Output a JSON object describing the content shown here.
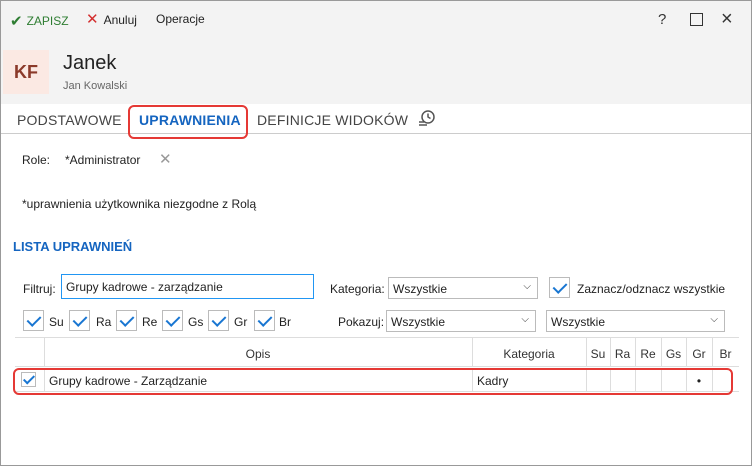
{
  "toolbar": {
    "save_label": "ZAPISZ",
    "cancel_label": "Anuluj",
    "operations_label": "Operacje",
    "help_label": "?"
  },
  "header": {
    "avatar_initials": "KF",
    "name": "Janek",
    "subtitle": "Jan Kowalski"
  },
  "tabs": [
    {
      "label": "PODSTAWOWE"
    },
    {
      "label": "UPRAWNIENIA",
      "active": true
    },
    {
      "label": "DEFINICJE WIDOKÓW"
    }
  ],
  "roles": {
    "label": "Role:",
    "value": "*Administrator"
  },
  "note": "*uprawnienia użytkownika niezgodne z Rolą",
  "section_title": "LISTA UPRAWNIEŃ",
  "filters": {
    "filter_label": "Filtruj:",
    "filter_value": "Grupy kadrowe - zarządzanie",
    "category_label": "Kategoria:",
    "category_value": "Wszystkie",
    "select_all_label": "Zaznacz/odznacz wszystkie",
    "show_label": "Pokazuj:",
    "show_value": "Wszystkie",
    "extra_value": "Wszystkie",
    "checkboxes": [
      {
        "label": "Su",
        "checked": true
      },
      {
        "label": "Ra",
        "checked": true
      },
      {
        "label": "Re",
        "checked": true
      },
      {
        "label": "Gs",
        "checked": true
      },
      {
        "label": "Gr",
        "checked": true
      },
      {
        "label": "Br",
        "checked": true
      }
    ]
  },
  "grid": {
    "columns": [
      "Opis",
      "Kategoria",
      "Su",
      "Ra",
      "Re",
      "Gs",
      "Gr",
      "Br"
    ],
    "rows": [
      {
        "checked": true,
        "opis": "Grupy kadrowe - Zarządzanie",
        "kategoria": "Kadry",
        "gr": "•"
      }
    ]
  },
  "colors": {
    "accent": "#1565c0",
    "save_green": "#2e7d32",
    "highlight_red": "#e53935"
  }
}
